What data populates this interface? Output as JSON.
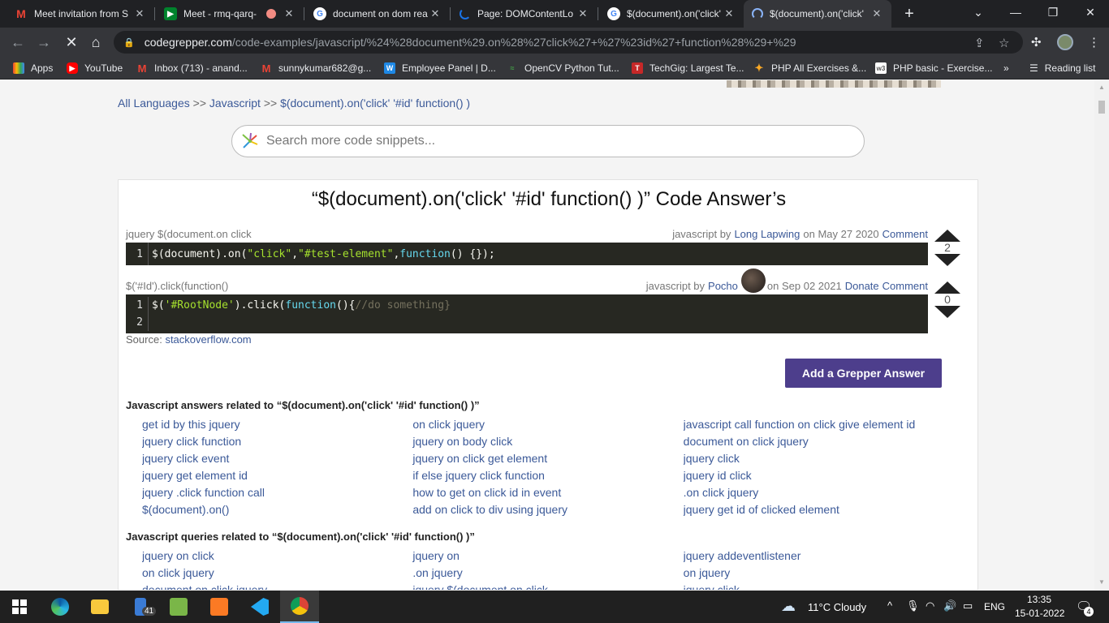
{
  "browser": {
    "tabs": [
      {
        "title": "Meet invitation from S",
        "icon": "gmail-icon",
        "color": "#ea4335",
        "letter": "M"
      },
      {
        "title": "Meet - rmq-qarq-",
        "icon": "meet-icon",
        "color": "#00832d",
        "letter": "▶"
      },
      {
        "title": "document on dom rea",
        "icon": "google-icon",
        "color": "#4285f4",
        "letter": "G"
      },
      {
        "title": "Page: DOMContentLo",
        "icon": "loading-icon",
        "color": "#1a73e8",
        "letter": ""
      },
      {
        "title": "$(document).on('click'",
        "icon": "google-icon",
        "color": "#4285f4",
        "letter": "G"
      },
      {
        "title": "$(document).on('click'",
        "icon": "loading-icon",
        "color": "#8ab4f8",
        "letter": ""
      }
    ],
    "url_host": "codegrepper.com",
    "url_path": "/code-examples/javascript/%24%28document%29.on%28%27click%27+%27%23id%27+function%28%29+%29",
    "bookmarks": [
      {
        "label": "Apps",
        "color": "#ea4335",
        "letter": "⋮"
      },
      {
        "label": "YouTube",
        "color": "#ff0000",
        "letter": "▶"
      },
      {
        "label": "Inbox (713) - anand...",
        "color": "#ea4335",
        "letter": "M"
      },
      {
        "label": "sunnykumar682@g...",
        "color": "#ea4335",
        "letter": "M"
      },
      {
        "label": "Employee Panel | D...",
        "color": "#1e88e5",
        "letter": "W"
      },
      {
        "label": "OpenCV Python Tut...",
        "color": "#2e7d32",
        "letter": "≈"
      },
      {
        "label": "TechGig: Largest Te...",
        "color": "#c62828",
        "letter": "T"
      },
      {
        "label": "PHP All Exercises &...",
        "color": "#f9a825",
        "letter": "✦"
      },
      {
        "label": "PHP basic - Exercise...",
        "color": "#6d6d6d",
        "letter": "w3"
      }
    ],
    "bookmarks_more": "»",
    "reading_list": "Reading list"
  },
  "page": {
    "breadcrumb": {
      "root": "All Languages",
      "sep1": ">>",
      "lang": "Javascript",
      "sep2": ">>",
      "current": "$(document).on('click' '#id' function() )"
    },
    "search_placeholder": "Search more code snippets...",
    "title": "“$(document).on('click' '#id' function() )” Code Answer’s",
    "answers": [
      {
        "label": "jquery $(document.on click",
        "lang": "javascript by",
        "author": "Long Lapwing",
        "date": "on May 27 2020",
        "actions": [
          "Comment"
        ],
        "votes": "2",
        "lines": [
          "1"
        ]
      },
      {
        "label": "$('#Id').click(function()",
        "lang": "javascript by",
        "author": "Pocho",
        "date": "on Sep 02 2021",
        "actions": [
          "Donate",
          "Comment"
        ],
        "votes": "0",
        "lines": [
          "1",
          "2"
        ]
      }
    ],
    "code1": {
      "a": "$(document).on(",
      "s1": "\"click\"",
      "c1": ",",
      "s2": "\"#test-element\"",
      "c2": ",",
      "kw": "function",
      "end": "() {});"
    },
    "code2": {
      "a": "$(",
      "s1": "'#RootNode'",
      "b": ").click(",
      "kw": "function",
      "c": "(){",
      "cmt": "//do something",
      "end": "}"
    },
    "source_label": "Source:",
    "source_link": "stackoverflow.com",
    "add_answer_label": "Add a Grepper Answer",
    "related_answers_title": "Javascript answers related to “$(document).on('click' '#id' function() )”",
    "related_answers": [
      [
        "get id by this jquery",
        "on click jquery",
        "javascript call function on click give element id"
      ],
      [
        "jquery click function",
        "jquery on body click",
        "document on click jquery"
      ],
      [
        "jquery click event",
        "jquery on click get element",
        "jquery click"
      ],
      [
        "jquery get element id",
        "if else jquery click function",
        "jquery id click"
      ],
      [
        "jquery .click function call",
        "how to get on click id in event",
        ".on click jquery"
      ],
      [
        "$(document).on()",
        "add on click to div using jquery",
        "jquery get id of clicked element"
      ]
    ],
    "related_queries_title": "Javascript queries related to “$(document).on('click' '#id' function() )”",
    "related_queries": [
      [
        "jquery on click",
        "jquery on",
        "jquery addeventlistener"
      ],
      [
        "on click jquery",
        ".on jquery",
        "on jquery"
      ],
      [
        "document on click jquery",
        "jquery $(document.on click",
        "jquery click"
      ]
    ]
  },
  "taskbar": {
    "badge_count": "41",
    "weather": "11°C  Cloudy",
    "language": "ENG",
    "time": "13:35",
    "date": "15-01-2022",
    "notifications": "4"
  }
}
